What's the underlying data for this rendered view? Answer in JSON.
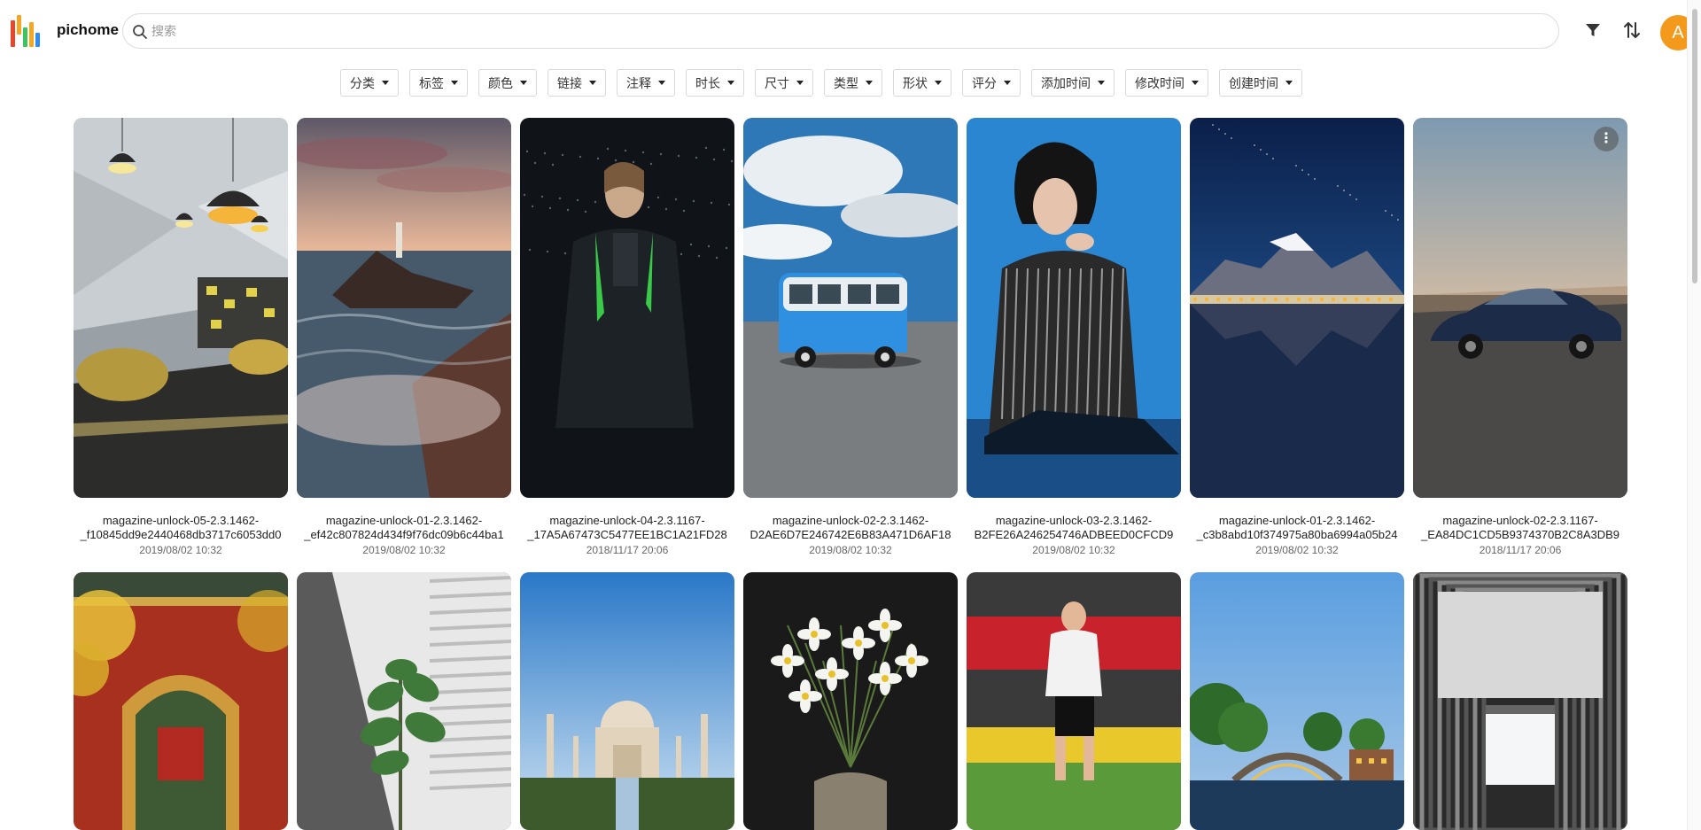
{
  "app": {
    "name": "pichome"
  },
  "search": {
    "placeholder": "搜索",
    "value": ""
  },
  "header": {
    "filter_icon": "filter-icon",
    "sort_icon": "sort-icon",
    "avatar_letter": "A",
    "avatar_color": "#f39a1d"
  },
  "filters": [
    "分类",
    "标签",
    "颜色",
    "链接",
    "注释",
    "时长",
    "尺寸",
    "类型",
    "形状",
    "评分",
    "添加时间",
    "修改时间",
    "创建时间"
  ],
  "images": [
    {
      "line1": "magazine-unlock-05-2.3.1462-",
      "line2": "_f10845dd9e2440468db3717c6053dd0",
      "date": "2019/08/02 10:32",
      "scene": "interior"
    },
    {
      "line1": "magazine-unlock-01-2.3.1462-",
      "line2": "_ef42c807824d434f9f76dc09b6c44ba1",
      "date": "2019/08/02 10:32",
      "scene": "lighthouse"
    },
    {
      "line1": "magazine-unlock-04-2.3.1167-",
      "line2": "_17A5A67473C5477EE1BC1A21FD28",
      "date": "2018/11/17 20:06",
      "scene": "rain-man"
    },
    {
      "line1": "magazine-unlock-02-2.3.1462-",
      "line2": "D2AE6D7E246742E6B83A471D6AF18",
      "date": "2019/08/02 10:32",
      "scene": "van"
    },
    {
      "line1": "magazine-unlock-03-2.3.1462-",
      "line2": "B2FE26A246254746ADBEED0CFCD9",
      "date": "2019/08/02 10:32",
      "scene": "woman"
    },
    {
      "line1": "magazine-unlock-01-2.3.1462-",
      "line2": "_c3b8abd10f374975a80ba6994a05b24",
      "date": "2019/08/02 10:32",
      "scene": "mountain"
    },
    {
      "line1": "magazine-unlock-02-2.3.1167-",
      "line2": "_EA84DC1CD5B9374370B2C8A3DB9",
      "date": "2018/11/17 20:06",
      "scene": "car"
    },
    {
      "line1": "",
      "line2": "",
      "date": "",
      "scene": "gate"
    },
    {
      "line1": "",
      "line2": "",
      "date": "",
      "scene": "plant"
    },
    {
      "line1": "",
      "line2": "",
      "date": "",
      "scene": "tajmahal"
    },
    {
      "line1": "",
      "line2": "",
      "date": "",
      "scene": "flowers"
    },
    {
      "line1": "",
      "line2": "",
      "date": "",
      "scene": "football"
    },
    {
      "line1": "",
      "line2": "",
      "date": "",
      "scene": "bridge"
    },
    {
      "line1": "",
      "line2": "",
      "date": "",
      "scene": "building"
    }
  ],
  "card_menu_icon": "more-vertical-icon"
}
